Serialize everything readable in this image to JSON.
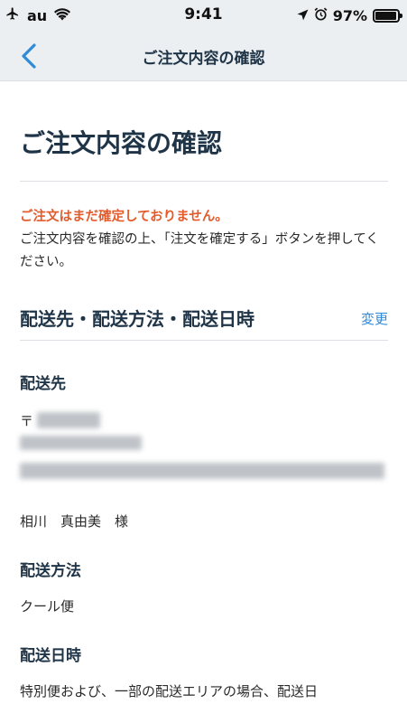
{
  "status_bar": {
    "carrier": "au",
    "time": "9:41",
    "battery_percent": "97%",
    "battery_level": 0.97
  },
  "nav": {
    "title": "ご注文内容の確認",
    "back_icon": "chevron-left-icon"
  },
  "page": {
    "title": "ご注文内容の確認",
    "warning": "ご注文はまだ確定しておりません。",
    "instruction": "ご注文内容を確認の上、「注文を確定する」ボタンを押してください。"
  },
  "shipping_section": {
    "title": "配送先・配送方法・配送日時",
    "change_label": "変更",
    "address": {
      "label": "配送先",
      "zip_mark": "〒",
      "recipient": "相川　真由美　様"
    },
    "method": {
      "label": "配送方法",
      "value": "クール便"
    },
    "datetime": {
      "label": "配送日時",
      "text": "特別便および、一部の配送エリアの場合、配送日"
    }
  },
  "colors": {
    "nav_background": "#eceff1",
    "heading": "#1f3447",
    "warning": "#e45a2b",
    "link": "#2f8ad8"
  }
}
